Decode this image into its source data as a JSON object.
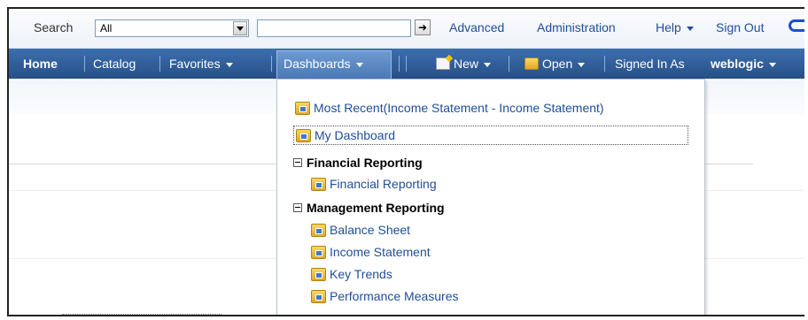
{
  "topbar": {
    "search_label": "Search",
    "scope_value": "All",
    "search_value": "",
    "advanced": "Advanced",
    "administration": "Administration",
    "help": "Help",
    "sign_out": "Sign Out"
  },
  "navbar": {
    "home": "Home",
    "catalog": "Catalog",
    "favorites": "Favorites",
    "dashboards": "Dashboards",
    "new": "New",
    "open": "Open",
    "signed_in_as": "Signed In As",
    "user": "weblogic"
  },
  "dropdown": {
    "most_recent": "Most Recent(Income Statement - Income Statement)",
    "my_dashboard": "My Dashboard",
    "groups": [
      {
        "title": "Financial Reporting",
        "items": [
          "Financial Reporting"
        ]
      },
      {
        "title": "Management Reporting",
        "items": [
          "Balance Sheet",
          "Income Statement",
          "Key Trends",
          "Performance Measures"
        ]
      }
    ]
  },
  "colors": {
    "nav_bg": "#2f5e9c",
    "link": "#1f4e99",
    "accent": "#1a50c8"
  }
}
